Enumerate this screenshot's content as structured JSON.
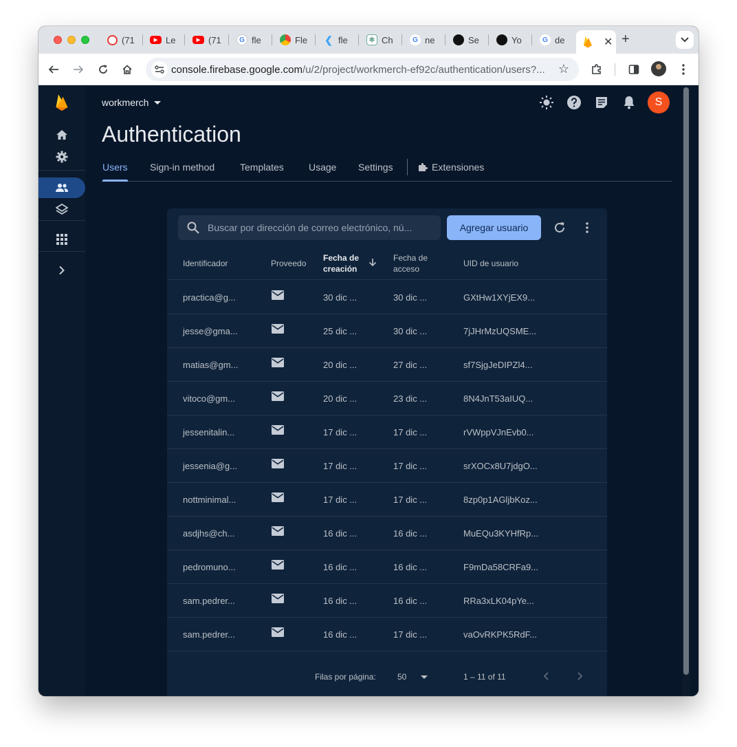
{
  "browser": {
    "tabs": [
      {
        "label": "(71",
        "icon": "youtube-music-icon"
      },
      {
        "label": "Le",
        "icon": "youtube-icon"
      },
      {
        "label": "(71",
        "icon": "youtube-icon"
      },
      {
        "label": "fle",
        "icon": "google-icon"
      },
      {
        "label": "Fle",
        "icon": "chrome-web-icon"
      },
      {
        "label": "fle",
        "icon": "flutter-icon"
      },
      {
        "label": "Ch",
        "icon": "chatgpt-icon"
      },
      {
        "label": "ne",
        "icon": "google-icon"
      },
      {
        "label": "Se",
        "icon": "github-icon"
      },
      {
        "label": "Yo",
        "icon": "github-icon"
      },
      {
        "label": "de",
        "icon": "google-icon"
      }
    ],
    "active_tab_icon": "firebase-icon",
    "url_host": "console.firebase.google.com",
    "url_path": "/u/2/project/workmerch-ef92c/authentication/users?..."
  },
  "app": {
    "project_name": "workmerch",
    "user_initial": "S",
    "page_title": "Authentication",
    "tabs": [
      "Users",
      "Sign-in method",
      "Templates",
      "Usage",
      "Settings",
      "Extensiones"
    ],
    "active_tab": "Users"
  },
  "users_table": {
    "search_placeholder": "Buscar por dirección de correo electrónico, nú...",
    "add_user_label": "Agregar usuario",
    "columns": {
      "identifier": "Identificador",
      "provider": "Proveedo",
      "created_l1": "Fecha de",
      "created_l2": "creación",
      "signed_in_l1": "Fecha de",
      "signed_in_l2": "acceso",
      "uid": "UID de usuario"
    },
    "sort": {
      "column": "created",
      "direction": "descending"
    },
    "rows": [
      {
        "identifier": "practica@g...",
        "provider": "email",
        "created": "30 dic ...",
        "signed_in": "30 dic ...",
        "uid": "GXtHw1XYjEX9..."
      },
      {
        "identifier": "jesse@gma...",
        "provider": "email",
        "created": "25 dic ...",
        "signed_in": "30 dic ...",
        "uid": "7jJHrMzUQSME..."
      },
      {
        "identifier": "matias@gm...",
        "provider": "email",
        "created": "20 dic ...",
        "signed_in": "27 dic ...",
        "uid": "sf7SjgJeDIPZl4..."
      },
      {
        "identifier": "vitoco@gm...",
        "provider": "email",
        "created": "20 dic ...",
        "signed_in": "23 dic ...",
        "uid": "8N4JnT53aIUQ..."
      },
      {
        "identifier": "jessenitalin...",
        "provider": "email",
        "created": "17 dic ...",
        "signed_in": "17 dic ...",
        "uid": "rVWppVJnEvb0..."
      },
      {
        "identifier": "jessenia@g...",
        "provider": "email",
        "created": "17 dic ...",
        "signed_in": "17 dic ...",
        "uid": "srXOCx8U7jdgO..."
      },
      {
        "identifier": "nottminimal...",
        "provider": "email",
        "created": "17 dic ...",
        "signed_in": "17 dic ...",
        "uid": "8zp0p1AGljbKoz..."
      },
      {
        "identifier": "asdjhs@ch...",
        "provider": "email",
        "created": "16 dic ...",
        "signed_in": "16 dic ...",
        "uid": "MuEQu3KYHfRp..."
      },
      {
        "identifier": "pedromuno...",
        "provider": "email",
        "created": "16 dic ...",
        "signed_in": "16 dic ...",
        "uid": "F9mDa58CRFa9..."
      },
      {
        "identifier": "sam.pedrer...",
        "provider": "email",
        "created": "16 dic ...",
        "signed_in": "16 dic ...",
        "uid": "RRa3xLK04pYe..."
      },
      {
        "identifier": "sam.pedrer...",
        "provider": "email",
        "created": "16 dic ...",
        "signed_in": "17 dic ...",
        "uid": "vaOvRKPK5RdF..."
      }
    ],
    "pagination": {
      "rows_per_page_label": "Filas por página:",
      "rows_per_page": "50",
      "range": "1 – 11 of 11"
    }
  },
  "colors": {
    "accent": "#8ab4f8",
    "background": "#08162a",
    "card": "#0f233b",
    "avatar": "#f4511e",
    "firebase_yellow": "#ffca28"
  }
}
